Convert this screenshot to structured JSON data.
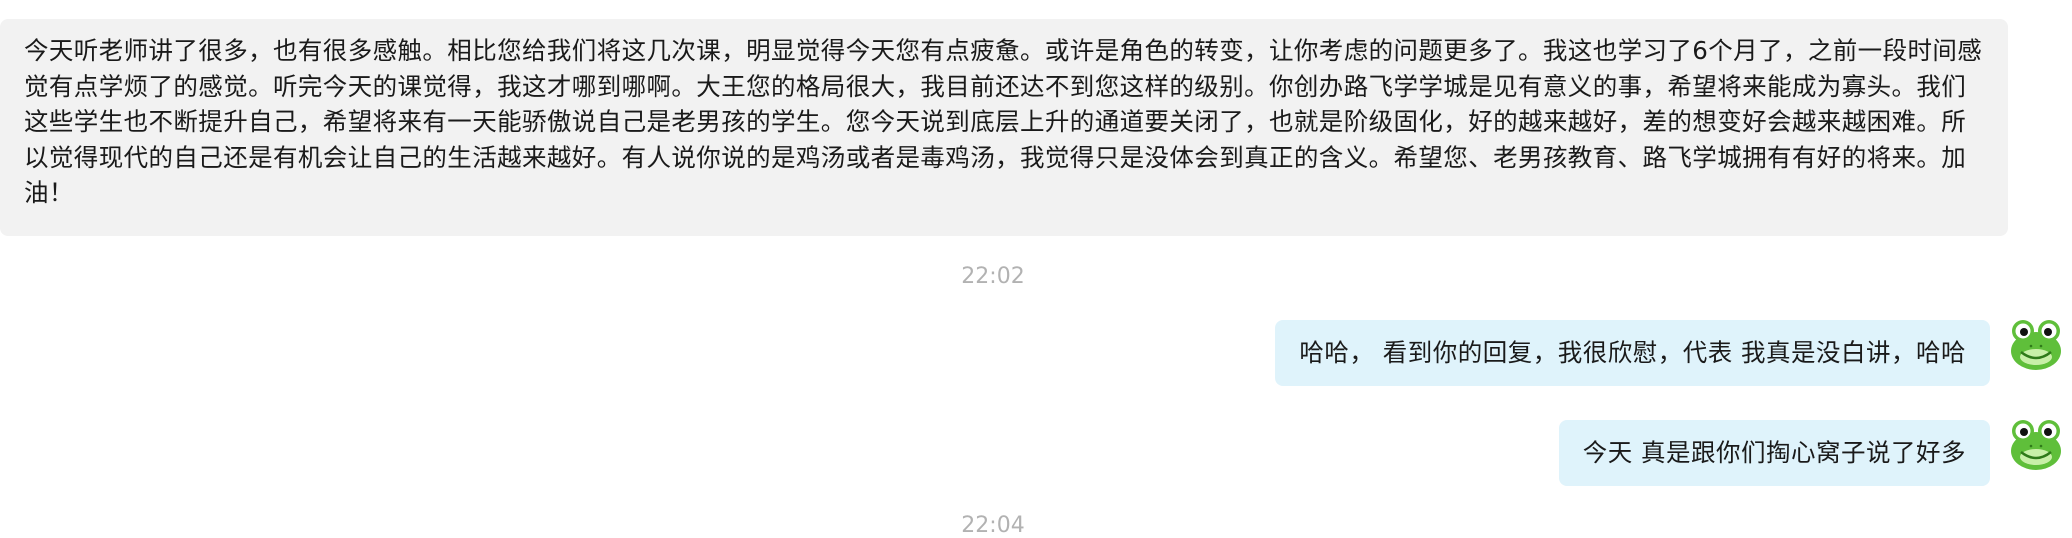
{
  "messages": [
    {
      "direction": "incoming",
      "text": "今天听老师讲了很多，也有很多感触。相比您给我们将这几次课，明显觉得今天您有点疲惫。或许是角色的转变，让你考虑的问题更多了。我这也学习了6个月了，之前一段时间感觉有点学烦了的感觉。听完今天的课觉得，我这才哪到哪啊。大王您的格局很大，我目前还达不到您这样的级别。你创办路飞学学城是见有意义的事，希望将来能成为寡头。我们这些学生也不断提升自己，希望将来有一天能骄傲说自己是老男孩的学生。您今天说到底层上升的通道要关闭了，也就是阶级固化，好的越来越好，差的想变好会越来越困难。所以觉得现代的自己还是有机会让自己的生活越来越好。有人说你说的是鸡汤或者是毒鸡汤，我觉得只是没体会到真正的含义。希望您、老男孩教育、路飞学城拥有有好的将来。加油！"
    },
    {
      "timestamp": "22:02"
    },
    {
      "direction": "outgoing",
      "text": "哈哈， 看到你的回复，我很欣慰，代表 我真是没白讲，哈哈",
      "avatar": "frog-avatar-icon"
    },
    {
      "direction": "outgoing",
      "text": "今天 真是跟你们掏心窝子说了好多",
      "avatar": "frog-avatar-icon"
    },
    {
      "timestamp": "22:04"
    }
  ],
  "colors": {
    "incoming_bubble": "#f2f2f2",
    "outgoing_bubble": "#dff3fb",
    "timestamp": "#b2b2b2",
    "frog": "#6cc644"
  }
}
